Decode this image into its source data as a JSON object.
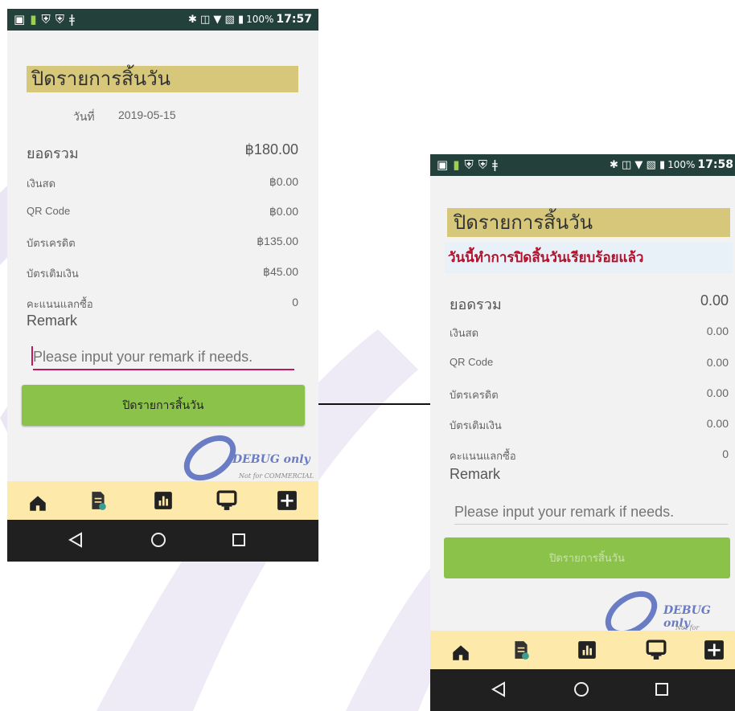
{
  "screen_before": {
    "status": {
      "battery": "100%",
      "time": "17:57"
    },
    "title": "ปิดรายการสิ้นวัน",
    "date_label": "วันที่",
    "date_value": "2019-05-15",
    "total_label": "ยอดรวม",
    "total_value": "฿180.00",
    "rows": [
      {
        "label": "เงินสด",
        "value": "฿0.00"
      },
      {
        "label": "QR Code",
        "value": "฿0.00"
      },
      {
        "label": "บัตรเครดิต",
        "value": "฿135.00"
      },
      {
        "label": "บัตรเติมเงิน",
        "value": "฿45.00"
      },
      {
        "label": "คะแนนแลกซื้อ",
        "value": "0"
      }
    ],
    "remark_label": "Remark",
    "remark_placeholder": "Please input your remark if needs.",
    "close_button": "ปิดรายการสิ้นวัน",
    "debug_text": "DEBUG only",
    "debug_sub": "Not for COMMERCIAL"
  },
  "screen_after": {
    "status": {
      "battery": "100%",
      "time": "17:58"
    },
    "title": "ปิดรายการสิ้นวัน",
    "success_message": "วันนี้ทำการปิดสิ้นวันเรียบร้อยแล้ว",
    "total_label": "ยอดรวม",
    "total_value": "0.00",
    "rows": [
      {
        "label": "เงินสด",
        "value": "0.00"
      },
      {
        "label": "QR Code",
        "value": "0.00"
      },
      {
        "label": "บัตรเครดิต",
        "value": "0.00"
      },
      {
        "label": "บัตรเติมเงิน",
        "value": "0.00"
      },
      {
        "label": "คะแนนแลกซื้อ",
        "value": "0"
      }
    ],
    "remark_label": "Remark",
    "remark_placeholder": "Please input your remark if needs.",
    "close_button": "ปิดรายการสิ้นวัน",
    "debug_text": "DEBUG only",
    "debug_sub": "Not for COMMERCIAL"
  },
  "nav_icons": [
    "home-icon",
    "receipt-icon",
    "report-icon",
    "pos-icon",
    "add-icon"
  ],
  "colors": {
    "accent_green": "#8bc34a",
    "title_bg": "#d6c77b",
    "nav_bg": "#fde9a9",
    "status_bg": "#23403a",
    "success_red": "#b2102b",
    "input_underline": "#c2185b"
  }
}
